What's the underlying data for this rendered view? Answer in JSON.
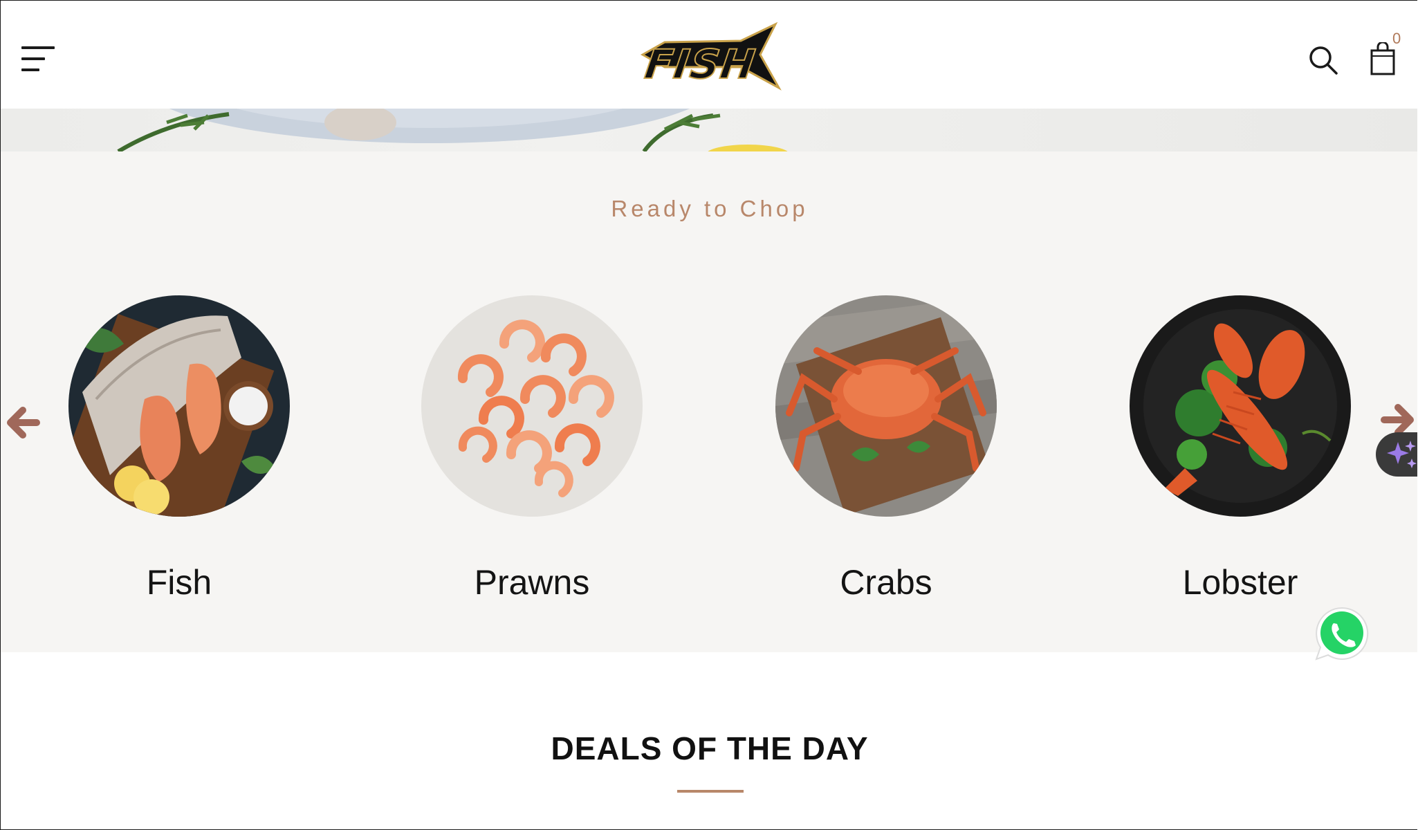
{
  "header": {
    "logo_text": "FISH",
    "cart_count": "0"
  },
  "categories_section": {
    "subtitle": "Ready to Chop",
    "items": [
      {
        "label": "Fish"
      },
      {
        "label": "Prawns"
      },
      {
        "label": "Crabs"
      },
      {
        "label": "Lobster"
      }
    ]
  },
  "deals_section": {
    "title": "DEALS OF THE DAY"
  },
  "colors": {
    "accent": "#b8876a",
    "section_bg": "#f6f5f3",
    "text": "#141414",
    "whatsapp": "#25d366"
  },
  "icons": [
    "menu-icon",
    "search-icon",
    "cart-icon",
    "arrow-left-icon",
    "arrow-right-icon",
    "sparkle-icon",
    "whatsapp-icon"
  ]
}
